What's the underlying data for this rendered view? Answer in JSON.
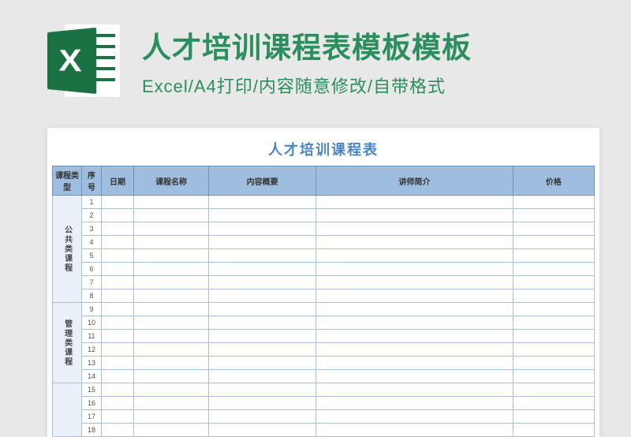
{
  "header": {
    "title": "人才培训课程表模板模板",
    "subtitle": "Excel/A4打印/内容随意修改/自带格式"
  },
  "chart_data": {
    "type": "table",
    "title": "人才培训课程表",
    "columns": [
      "课程类型",
      "序号",
      "日期",
      "课程名称",
      "内容概要",
      "讲师简介",
      "价格"
    ],
    "groups": [
      {
        "type_label": "公共类课程",
        "rows": [
          1,
          2,
          3,
          4,
          5,
          6,
          7,
          8
        ]
      },
      {
        "type_label": "管理类课程",
        "rows": [
          9,
          10,
          11,
          12,
          13,
          14
        ]
      },
      {
        "type_label": "",
        "rows": [
          15,
          16,
          17,
          18
        ]
      }
    ]
  }
}
